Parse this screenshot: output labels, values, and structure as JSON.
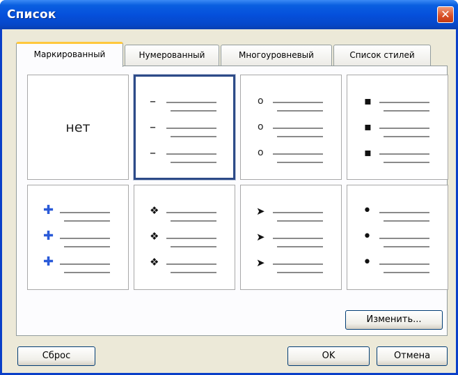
{
  "window": {
    "title": "Список",
    "close_symbol": "✕"
  },
  "tabs": [
    {
      "label": "Маркированный",
      "active": true
    },
    {
      "label": "Нумерованный",
      "active": false
    },
    {
      "label": "Многоуровневый",
      "active": false
    },
    {
      "label": "Список стилей",
      "active": false
    }
  ],
  "gallery": {
    "none_label": "нет",
    "selected_index": 1,
    "bullet_styles": [
      {
        "name": "none",
        "glyph": ""
      },
      {
        "name": "dash",
        "glyph": "–"
      },
      {
        "name": "hollow-circle",
        "glyph": "o"
      },
      {
        "name": "square",
        "glyph": "▪"
      },
      {
        "name": "picture",
        "glyph": "✚"
      },
      {
        "name": "four-diamond",
        "glyph": "❖"
      },
      {
        "name": "arrowhead",
        "glyph": "➤"
      },
      {
        "name": "solid-circle",
        "glyph": "•"
      }
    ]
  },
  "buttons": {
    "modify": "Изменить...",
    "reset": "Сброс",
    "ok": "OK",
    "cancel": "Отмена"
  },
  "colors": {
    "titlebar": "#0550dc",
    "selection_border": "#2c4a88",
    "tab_highlight": "#ffc83c"
  }
}
